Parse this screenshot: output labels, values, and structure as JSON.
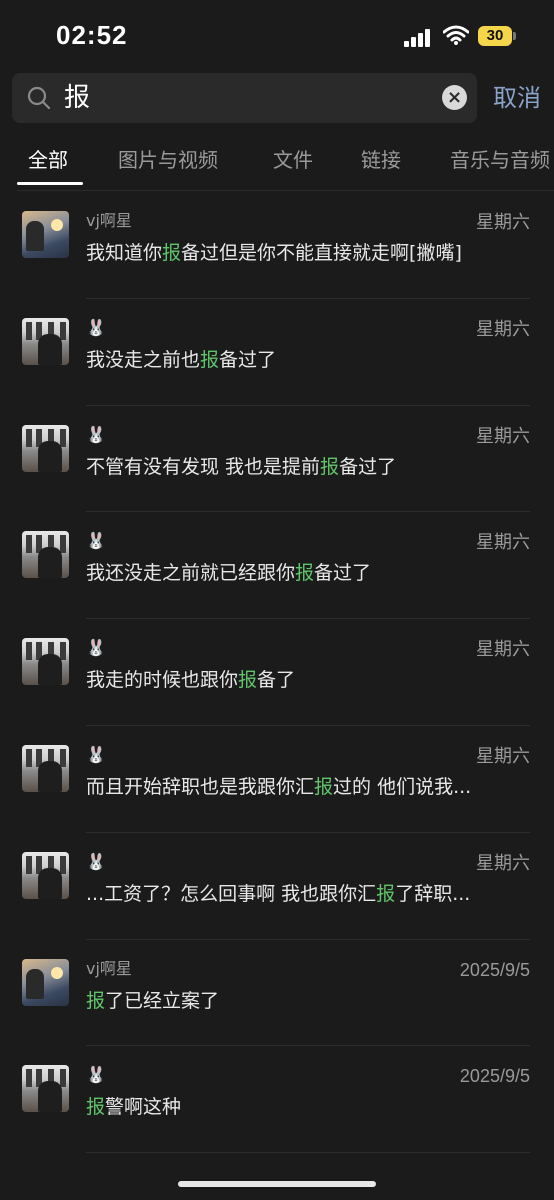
{
  "status_bar": {
    "time": "02:52",
    "battery": "30"
  },
  "search": {
    "query": "报",
    "cancel_label": "取消"
  },
  "tabs": [
    {
      "label": "全部",
      "active": true
    },
    {
      "label": "图片与视频",
      "active": false
    },
    {
      "label": "文件",
      "active": false
    },
    {
      "label": "链接",
      "active": false
    },
    {
      "label": "音乐与音频",
      "active": false
    }
  ],
  "results": [
    {
      "avatar": "vj",
      "sender": "vj啊星",
      "date": "星期六",
      "pre": "我知道你",
      "hl": "报",
      "post": "备过但是你不能直接就走啊[撇嘴]"
    },
    {
      "avatar": "rb",
      "sender": "🐰",
      "date": "星期六",
      "pre": "我没走之前也",
      "hl": "报",
      "post": "备过了"
    },
    {
      "avatar": "rb",
      "sender": "🐰",
      "date": "星期六",
      "pre": "不管有没有发现 我也是提前",
      "hl": "报",
      "post": "备过了"
    },
    {
      "avatar": "rb",
      "sender": "🐰",
      "date": "星期六",
      "pre": "我还没走之前就已经跟你",
      "hl": "报",
      "post": "备过了"
    },
    {
      "avatar": "rb",
      "sender": "🐰",
      "date": "星期六",
      "pre": "我走的时候也跟你",
      "hl": "报",
      "post": "备了"
    },
    {
      "avatar": "rb",
      "sender": "🐰",
      "date": "星期六",
      "pre": "而且开始辞职也是我跟你汇",
      "hl": "报",
      "post": "过的 他们说我..."
    },
    {
      "avatar": "rb",
      "sender": "🐰",
      "date": "星期六",
      "pre": "...工资了？怎么回事啊 我也跟你汇",
      "hl": "报",
      "post": "了辞职..."
    },
    {
      "avatar": "vj",
      "sender": "vj啊星",
      "date": "2025/9/5",
      "pre": "",
      "hl": "报",
      "post": "了已经立案了"
    },
    {
      "avatar": "rb",
      "sender": "🐰",
      "date": "2025/9/5",
      "pre": "",
      "hl": "报",
      "post": "警啊这种"
    }
  ],
  "colors": {
    "background": "#1b1b1b",
    "highlight": "#5fc56b",
    "cancel": "#8aa3c8"
  },
  "icons": {
    "search": "search-icon",
    "clear": "clear-icon",
    "signal": "signal-icon",
    "wifi": "wifi-icon"
  }
}
